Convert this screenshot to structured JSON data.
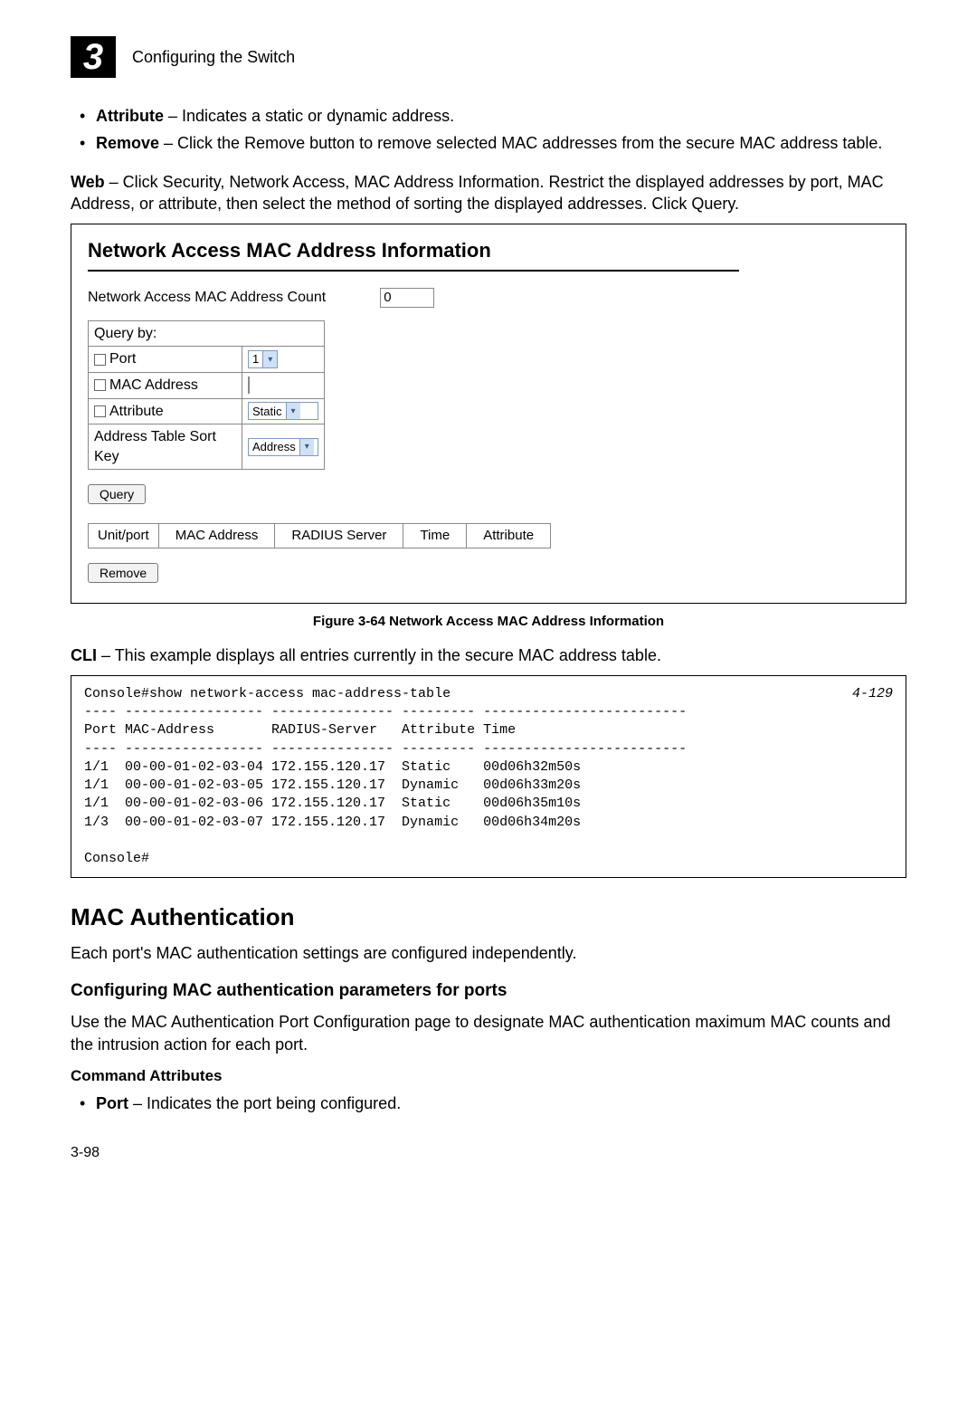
{
  "header": {
    "chapter_number": "3",
    "chapter_title": "Configuring the Switch"
  },
  "bullets_top": [
    {
      "term": "Attribute",
      "desc": " – Indicates a static or dynamic address."
    },
    {
      "term": "Remove",
      "desc": " – Click the Remove button to remove selected MAC addresses from the secure MAC address table."
    }
  ],
  "web_para": {
    "term": "Web",
    "desc": " – Click Security, Network Access, MAC Address Information. Restrict the displayed addresses by port, MAC Address, or attribute, then select the method of sorting the displayed addresses. Click Query."
  },
  "figure": {
    "title": "Network Access MAC Address Information",
    "count_label": "Network Access MAC Address Count",
    "count_value": "0",
    "query_by_label": "Query by:",
    "rows": {
      "port_label": "Port",
      "port_value": "1",
      "mac_label": "MAC Address",
      "attr_label": "Attribute",
      "attr_value": "Static",
      "sortkey_label": "Address Table Sort Key",
      "sortkey_value": "Address"
    },
    "query_btn": "Query",
    "result_headers": [
      "Unit/port",
      "MAC Address",
      "RADIUS Server",
      "Time",
      "Attribute"
    ],
    "remove_btn": "Remove",
    "caption": "Figure 3-64  Network Access MAC Address Information"
  },
  "cli": {
    "term": "CLI",
    "desc": " – This example displays all entries currently in the secure MAC address table.",
    "ref": "4-129",
    "line1": "Console#show network-access mac-address-table",
    "line2": "---- ----------------- --------------- --------- -------------------------",
    "line3": "Port MAC-Address       RADIUS-Server   Attribute Time",
    "line4": "---- ----------------- --------------- --------- -------------------------",
    "line5": "1/1  00-00-01-02-03-04 172.155.120.17  Static    00d06h32m50s",
    "line6": "1/1  00-00-01-02-03-05 172.155.120.17  Dynamic   00d06h33m20s",
    "line7": "1/1  00-00-01-02-03-06 172.155.120.17  Static    00d06h35m10s",
    "line8": "1/3  00-00-01-02-03-07 172.155.120.17  Dynamic   00d06h34m20s",
    "line9": "",
    "line10": "Console#"
  },
  "mac_auth": {
    "title": "MAC Authentication",
    "intro": "Each port's MAC authentication settings are configured independently.",
    "sub_title": "Configuring MAC authentication parameters for ports",
    "sub_desc": "Use the MAC Authentication Port Configuration page to designate MAC authentication maximum MAC counts and the intrusion action for each port.",
    "attr_title": "Command Attributes",
    "attr_bullets": [
      {
        "term": "Port",
        "desc": " – Indicates the port being configured."
      }
    ]
  },
  "page_number": "3-98"
}
